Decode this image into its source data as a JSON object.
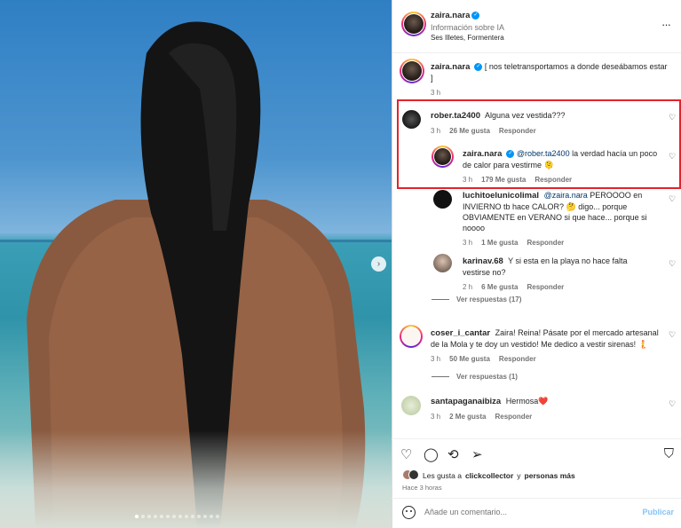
{
  "header": {
    "username": "zaira.nara",
    "ai_info": "Información sobre IA",
    "location": "Ses Illetes, Formentera",
    "more": "···"
  },
  "caption": {
    "username": "zaira.nara",
    "text": "[ nos teletransportamos a donde deseábamos estar ]",
    "time": "3 h"
  },
  "comments": [
    {
      "username": "rober.ta2400",
      "text": "Alguna vez vestida???",
      "time": "3 h",
      "likes": "26 Me gusta",
      "reply": "Responder"
    },
    {
      "username": "zaira.nara",
      "mention": "@rober.ta2400",
      "text": "la verdad hacía un poco de calor para vestirme 🫠",
      "time": "3 h",
      "likes": "179 Me gusta",
      "reply": "Responder"
    },
    {
      "username": "luchitoelunicolimal",
      "mention": "@zaira.nara",
      "text": "PEROOOO en INVIERNO tb hace CALOR? 🤔 digo... porque OBVIAMENTE en VERANO si que hace... porque si noooo",
      "time": "3 h",
      "likes": "1 Me gusta",
      "reply": "Responder"
    },
    {
      "username": "karinav.68",
      "text": "Y si esta en la playa no hace falta vestirse no?",
      "time": "2 h",
      "likes": "6 Me gusta",
      "reply": "Responder"
    },
    {
      "username": "coser_i_cantar",
      "text": "Zaira! Reina! Pásate por el mercado artesanal de la Mola y te doy un vestido! Me dedico a vestir sirenas! 🧜",
      "time": "3 h",
      "likes": "50 Me gusta",
      "reply": "Responder"
    },
    {
      "username": "santapaganaibiza",
      "text": "Hermosa❤️",
      "time": "3 h",
      "likes": "2 Me gusta",
      "reply": "Responder"
    }
  ],
  "view_replies_1": "Ver respuestas (17)",
  "view_replies_2": "Ver respuestas (1)",
  "liked_by_prefix": "Les gusta a",
  "liked_by_user": "clickcollector",
  "liked_by_suffix": "y",
  "liked_by_more": "personas más",
  "posted_ago": "Hace 3 horas",
  "add_comment_placeholder": "Añade un comentario...",
  "publish_label": "Publicar",
  "carousel": {
    "total": 14,
    "active": 1
  },
  "colors": {
    "highlight": "#e0242b",
    "verified": "#0095f6",
    "link": "#00376b"
  }
}
